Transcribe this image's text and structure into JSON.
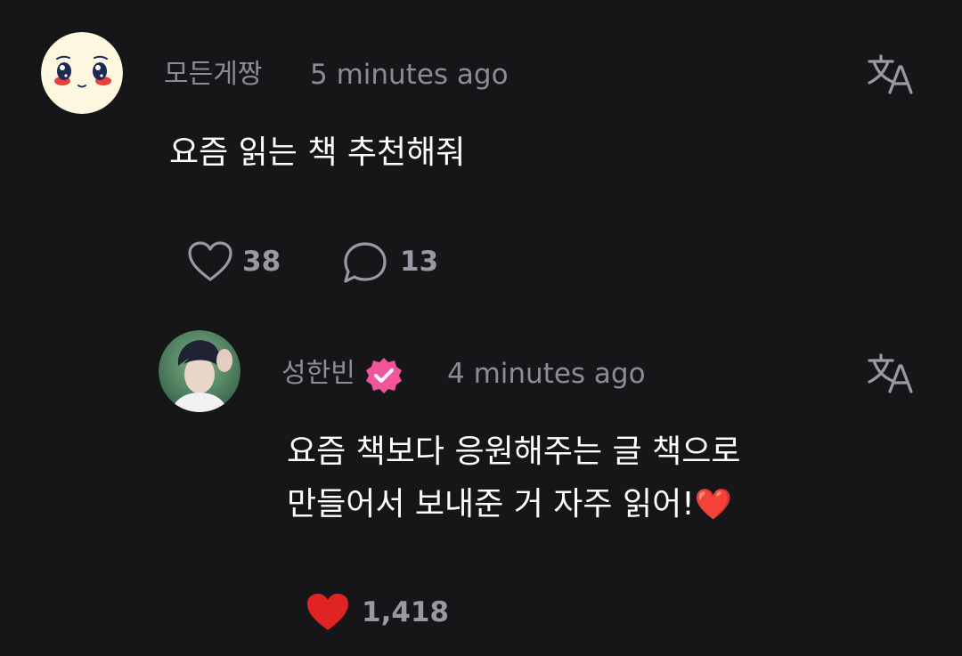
{
  "comment": {
    "username": "모든게짱",
    "time": "5 minutes ago",
    "text": "요즘 읽는 책 추천해줘",
    "likes": "38",
    "replies": "13",
    "translate_icon": "translate-icon",
    "like_icon": "heart-outline-icon",
    "reply_icon": "speech-bubble-icon"
  },
  "reply": {
    "username": "성한빈",
    "verified_icon": "verified-badge-icon",
    "time": "4 minutes ago",
    "text_line1": "요즘 책보다 응원해주는 글 책으로",
    "text_line2": "만들어서 보내준 거 자주 읽어!",
    "emoji": "❤️",
    "likes": "1,418",
    "translate_icon": "translate-icon",
    "like_icon": "heart-filled-icon",
    "liked": true
  },
  "colors": {
    "background": "#161619",
    "muted_text": "#8d8b95",
    "body_text": "#ffffff",
    "verified_badge": "#f2559b",
    "heart_filled": "#e02424"
  }
}
